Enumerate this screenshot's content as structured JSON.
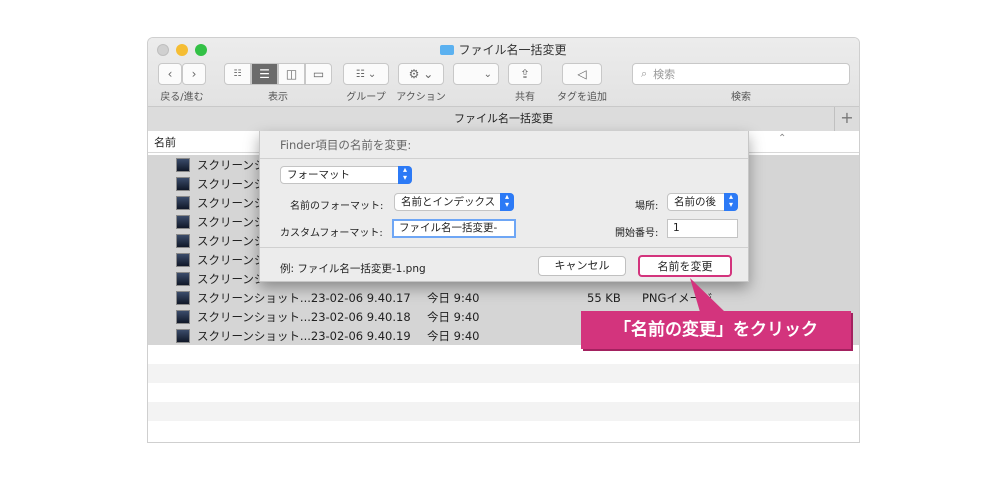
{
  "window": {
    "title": "ファイル名一括変更"
  },
  "toolbar": {
    "back_forward_label": "戻る/進む",
    "view_label": "表示",
    "group_label": "グループ",
    "action_label": "アクション",
    "share_label": "共有",
    "tag_label": "タグを追加",
    "search_placeholder": "検索",
    "search_label": "検索"
  },
  "pathbar": {
    "title": "ファイル名一括変更"
  },
  "columns": {
    "name": "名前"
  },
  "files": [
    {
      "name": "スクリーンシ",
      "date": "",
      "size": "",
      "kind": ""
    },
    {
      "name": "スクリーンシ",
      "date": "",
      "size": "",
      "kind": ""
    },
    {
      "name": "スクリーンシ",
      "date": "",
      "size": "",
      "kind": ""
    },
    {
      "name": "スクリーンシ",
      "date": "",
      "size": "",
      "kind": ""
    },
    {
      "name": "スクリーンシ",
      "date": "",
      "size": "",
      "kind": ""
    },
    {
      "name": "スクリーンシ",
      "date": "",
      "size": "",
      "kind": ""
    },
    {
      "name": "スクリーンシ",
      "date": "",
      "size": "",
      "kind": ""
    },
    {
      "name": "スクリーンショット...23-02-06 9.40.17",
      "date": "今日 9:40",
      "size": "55 KB",
      "kind": "PNGイメージ"
    },
    {
      "name": "スクリーンショット...23-02-06 9.40.18",
      "date": "今日 9:40",
      "size": "",
      "kind": ""
    },
    {
      "name": "スクリーンショット...23-02-06 9.40.19",
      "date": "今日 9:40",
      "size": "",
      "kind": ""
    }
  ],
  "dialog": {
    "title": "Finder項目の名前を変更:",
    "mode": "フォーマット",
    "name_format_label": "名前のフォーマット:",
    "name_format_value": "名前とインデックス",
    "location_label": "場所:",
    "location_value": "名前の後",
    "custom_format_label": "カスタムフォーマット:",
    "custom_format_value": "ファイル名一括変更-",
    "start_number_label": "開始番号:",
    "start_number_value": "1",
    "example": "例: ファイル名一括変更-1.png",
    "cancel": "キャンセル",
    "rename": "名前を変更"
  },
  "callout": {
    "text": "「名前の変更」をクリック"
  },
  "colors": {
    "accent": "#d3347d",
    "selected_row": "#d5d5d5",
    "stepper": "#2c7af6"
  }
}
